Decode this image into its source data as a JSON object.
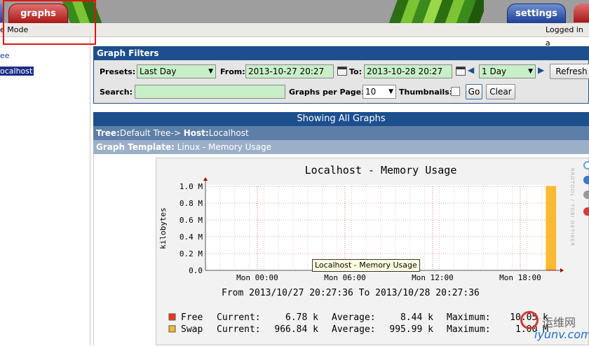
{
  "tabs": {
    "graphs": "graphs",
    "settings": "settings"
  },
  "mode_bar": {
    "left_text": "e Mode",
    "right_text": "Logged in a"
  },
  "tree": {
    "items": [
      "ee",
      "ocalhost"
    ]
  },
  "filters": {
    "heading": "Graph Filters",
    "presets_label": "Presets:",
    "presets_value": "Last Day",
    "from_label": "From:",
    "from_value": "2013-10-27 20:27",
    "to_label": "To:",
    "to_value": "2013-10-28 20:27",
    "shift_value": "1 Day",
    "refresh_label": "Refresh",
    "search_label": "Search:",
    "search_value": "",
    "per_page_label": "Graphs per Page:",
    "per_page_value": "10",
    "thumbnails_label": "Thumbnails:",
    "thumbnails_checked": false,
    "go_label": "Go",
    "clear_label": "Clear"
  },
  "graphs": {
    "heading": "Showing All Graphs",
    "tree_label": "Tree:",
    "tree_value": "Default Tree->",
    "host_label": "Host:",
    "host_value": "Localhost",
    "template_label": "Graph Template:",
    "template_value": "Linux - Memory Usage"
  },
  "chart_data": {
    "type": "area",
    "title": "Localhost - Memory Usage",
    "ylabel": "kilobytes",
    "y_ticks": [
      "0.0",
      "0.2 M",
      "0.4 M",
      "0.6 M",
      "0.8 M",
      "1.0 M"
    ],
    "x_ticks": [
      "Mon 00:00",
      "Mon 06:00",
      "Mon 12:00",
      "Mon 18:00"
    ],
    "time_range": "From 2013/10/27 20:27:36 To 2013/10/28 20:27:36",
    "side_text": "RRDTOOL / TOBI OETIKER",
    "grid": true,
    "series": [
      {
        "name": "Free",
        "color": "#f03c14",
        "current": "6.78 k",
        "average": "8.44 k",
        "maximum": "10.05 k"
      },
      {
        "name": "Swap",
        "color": "#fdb931",
        "current": "966.84 k",
        "average": "995.99 k",
        "maximum": "1.00 M"
      }
    ],
    "legend_labels": {
      "current": "Current:",
      "average": "Average:",
      "maximum": "Maximum:"
    }
  },
  "tooltip": "Localhost - Memory Usage",
  "watermark": {
    "line1": "运维网",
    "line2": "iyunv.com"
  }
}
